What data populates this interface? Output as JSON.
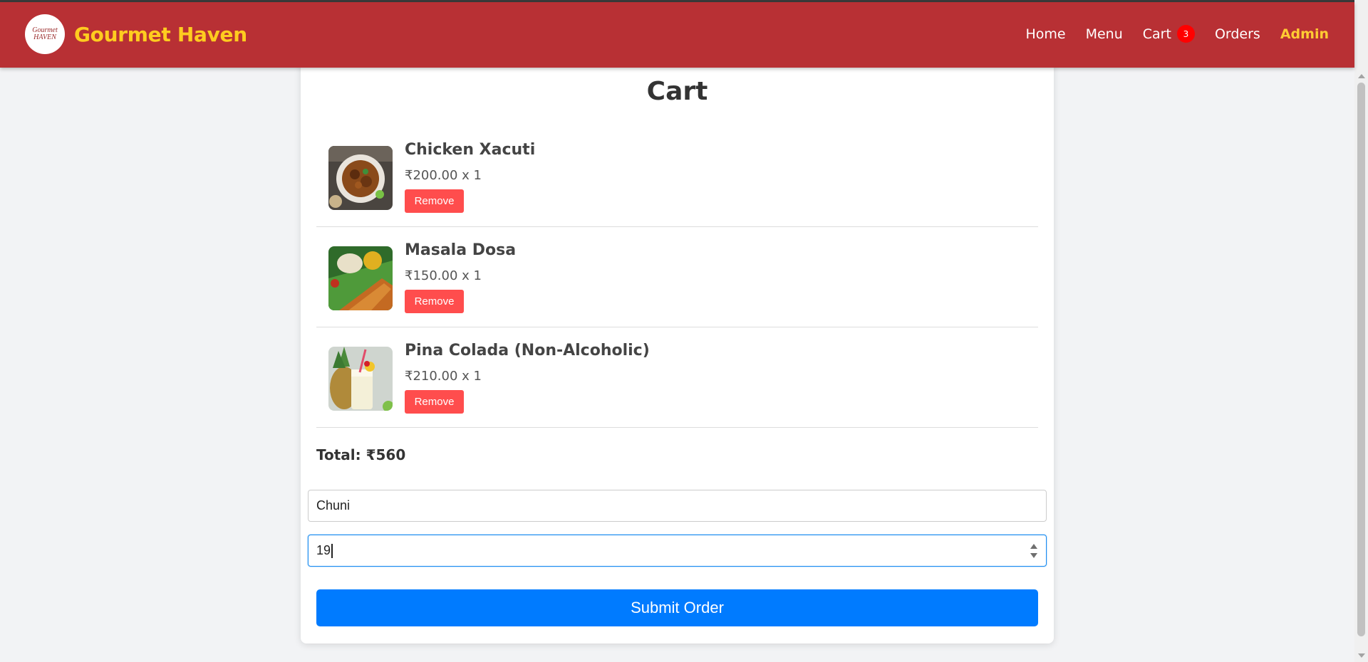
{
  "header": {
    "logo_text": "Gourmet\nHAVEN",
    "brand": "Gourmet Haven",
    "nav": [
      {
        "label": "Home"
      },
      {
        "label": "Menu"
      },
      {
        "label": "Cart",
        "badge": "3"
      },
      {
        "label": "Orders"
      },
      {
        "label": "Admin"
      }
    ]
  },
  "cart": {
    "title": "Cart",
    "items": [
      {
        "name": "Chicken Xacuti",
        "price": "₹200.00 x 1",
        "remove_label": "Remove"
      },
      {
        "name": "Masala Dosa",
        "price": "₹150.00 x 1",
        "remove_label": "Remove"
      },
      {
        "name": "Pina Colada (Non-Alcoholic)",
        "price": "₹210.00 x 1",
        "remove_label": "Remove"
      }
    ],
    "total": "Total: ₹560",
    "form": {
      "name_value": "Chuni",
      "number_value": "19",
      "submit_label": "Submit Order"
    }
  },
  "colors": {
    "navbar": "#b83034",
    "brand": "#ffcc1f",
    "admin_link": "#ffcc33",
    "badge": "#ff0000",
    "remove_button": "#ff4d4d",
    "submit_button": "#007bff"
  }
}
